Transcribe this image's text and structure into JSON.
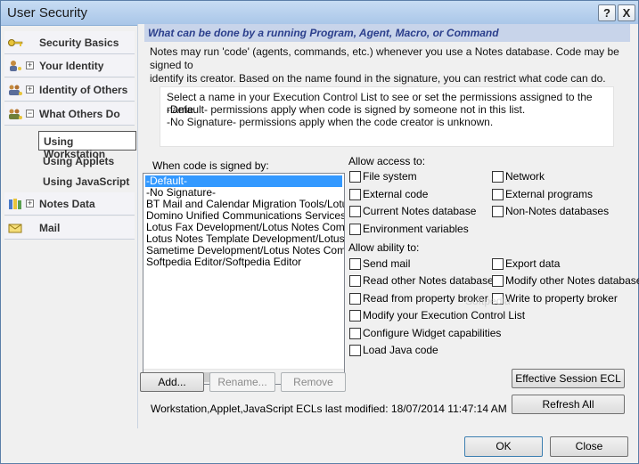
{
  "window": {
    "title": "User Security",
    "help_label": "?",
    "close_label": "X"
  },
  "sidebar": {
    "items": [
      {
        "label": "Security Basics",
        "expander": ""
      },
      {
        "label": "Your Identity",
        "expander": "+"
      },
      {
        "label": "Identity of Others",
        "expander": "+"
      },
      {
        "label": "What Others Do",
        "expander": "−"
      },
      {
        "label": "Notes Data",
        "expander": "+"
      },
      {
        "label": "Mail",
        "expander": ""
      }
    ],
    "subitems": [
      {
        "label": "Using Workstation",
        "selected": true
      },
      {
        "label": "Using Applets",
        "selected": false
      },
      {
        "label": "Using JavaScript",
        "selected": false
      }
    ]
  },
  "main": {
    "header": "What can be done by a running Program, Agent, Macro, or Command",
    "intro_line1": "Notes may run 'code' (agents, commands, etc.) whenever you use a Notes database. Code may be signed to",
    "intro_line2": "identify its creator. Based on the name found in the signature, you can restrict what code can do.",
    "info_line1": "Select a name in your Execution Control List to see or set the permissions assigned to the name.",
    "info_line2": "-Default- permissions apply when code is signed by someone not in this list.",
    "info_line3": "-No Signature- permissions apply when the code creator is unknown.",
    "list_label": "When code is signed by:",
    "signers": [
      "-Default-",
      "-No Signature-",
      "BT Mail and Calendar Migration Tools/Lotus Notes",
      "Domino Unified Communications Services/Lotus Notes",
      "Lotus Fax Development/Lotus Notes Companion",
      "Lotus Notes Template Development/Lotus Notes",
      "Sametime Development/Lotus Notes Companion",
      "Softpedia Editor/Softpedia Editor"
    ],
    "allow_access_label": "Allow access to:",
    "access": {
      "file_system": "File system",
      "network": "Network",
      "external_code": "External code",
      "external_programs": "External programs",
      "current_db": "Current Notes database",
      "non_notes_db": "Non-Notes databases",
      "env_vars": "Environment variables"
    },
    "allow_ability_label": "Allow ability to:",
    "ability": {
      "send_mail": "Send mail",
      "export_data": "Export data",
      "read_other_db": "Read other Notes databases",
      "modify_other_db": "Modify other Notes databases",
      "read_prop_broker": "Read from property broker",
      "write_prop_broker": "Write to property broker",
      "modify_ecl": "Modify your Execution Control List",
      "configure_widget": "Configure Widget capabilities",
      "load_java": "Load Java code"
    },
    "watermark": "Softpedia",
    "buttons": {
      "add": "Add...",
      "rename": "Rename...",
      "remove": "Remove",
      "effective_ecl": "Effective Session ECL",
      "refresh_all": "Refresh All"
    },
    "status": "Workstation,Applet,JavaScript ECLs last modified:  18/07/2014 11:47:14 AM"
  },
  "footer": {
    "ok": "OK",
    "close": "Close"
  }
}
